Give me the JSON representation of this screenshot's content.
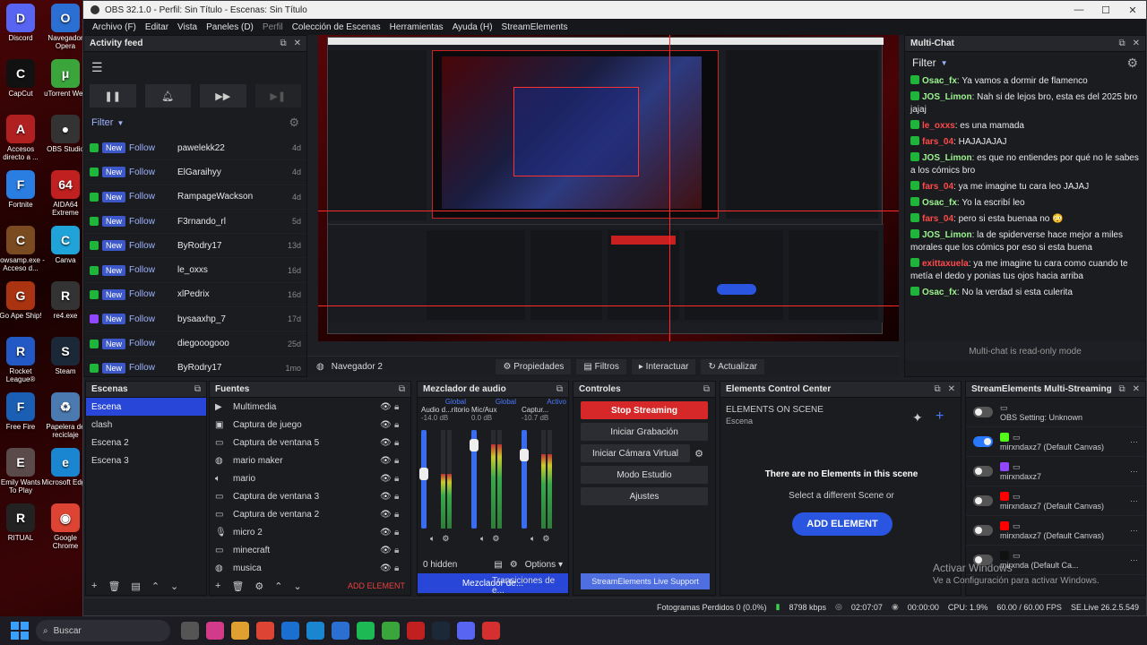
{
  "desktop": {
    "icons": [
      {
        "label": "Discord",
        "color": "#5865f2",
        "glyph": "D"
      },
      {
        "label": "Navegador Opera",
        "color": "#2a6fd1",
        "glyph": "O"
      },
      {
        "label": "CapCut",
        "color": "#111111",
        "glyph": "C"
      },
      {
        "label": "uTorrent Web",
        "color": "#3aa53a",
        "glyph": "μ"
      },
      {
        "label": "Accesos directo a ...",
        "color": "#b02020",
        "glyph": "A"
      },
      {
        "label": "OBS Studio",
        "color": "#333333",
        "glyph": "●"
      },
      {
        "label": "Fortnite",
        "color": "#2a7de1",
        "glyph": "F"
      },
      {
        "label": "AIDA64 Extreme",
        "color": "#c0201f",
        "glyph": "64"
      },
      {
        "label": "cowsamp.exe - Acceso d...",
        "color": "#7a4a20",
        "glyph": "C"
      },
      {
        "label": "Canva",
        "color": "#1fa3d8",
        "glyph": "C"
      },
      {
        "label": "Go Ape Ship!",
        "color": "#aa3311",
        "glyph": "G"
      },
      {
        "label": "re4.exe",
        "color": "#333333",
        "glyph": "R"
      },
      {
        "label": "Rocket League®",
        "color": "#2359c4",
        "glyph": "R"
      },
      {
        "label": "Steam",
        "color": "#1b2838",
        "glyph": "S"
      },
      {
        "label": "Free Fire",
        "color": "#1a5fb4",
        "glyph": "F"
      },
      {
        "label": "Papelera de reciclaje",
        "color": "#4a7ab0",
        "glyph": "♻"
      },
      {
        "label": "Emily Wants To Play",
        "color": "#5a4a4a",
        "glyph": "E"
      },
      {
        "label": "Microsoft Edge",
        "color": "#1a86d1",
        "glyph": "e"
      },
      {
        "label": "RITUAL",
        "color": "#222222",
        "glyph": "R"
      },
      {
        "label": "Google Chrome",
        "color": "#dd4433",
        "glyph": "◉"
      }
    ]
  },
  "window": {
    "title": "OBS 32.1.0 - Perfil: Sin Título - Escenas: Sin Título",
    "min": "—",
    "max": "☐",
    "close": "✕"
  },
  "menu": [
    "Archivo (F)",
    "Editar",
    "Vista",
    "Paneles (D)",
    "Perfil",
    "Colección de Escenas",
    "Herramientas",
    "Ayuda (H)",
    "StreamElements"
  ],
  "activity": {
    "title": "Activity feed",
    "filter": "Filter",
    "new": "New",
    "follow": "Follow",
    "items": [
      {
        "user": "pawelekk22",
        "time": "4d"
      },
      {
        "user": "ElGaraihyy",
        "time": "4d"
      },
      {
        "user": "RampageWackson",
        "time": "4d"
      },
      {
        "user": "F3rnando_rl",
        "time": "5d"
      },
      {
        "user": "ByRodry17",
        "time": "13d"
      },
      {
        "user": "le_oxxs",
        "time": "16d"
      },
      {
        "user": "xlPedrix",
        "time": "16d"
      },
      {
        "user": "bysaaxhp_7",
        "time": "17d"
      },
      {
        "user": "diegooogooo",
        "time": "25d"
      },
      {
        "user": "ByRodry17",
        "time": "1mo"
      }
    ]
  },
  "multichat": {
    "title": "Multi-Chat",
    "filter": "Filter",
    "footer": "Multi-chat is read-only mode",
    "messages": [
      {
        "user": "Osac_fx",
        "red": false,
        "text": "Ya vamos a dormir de flamenco"
      },
      {
        "user": "JOS_Limon",
        "red": false,
        "text": "Nah si de lejos bro, esta es del 2025 bro jajaj"
      },
      {
        "user": "le_oxxs",
        "red": true,
        "text": "es una mamada"
      },
      {
        "user": "fars_04",
        "red": true,
        "text": "HAJAJAJAJ"
      },
      {
        "user": "JOS_Limon",
        "red": false,
        "text": "es que no entiendes por qué no le sabes a los cómics bro"
      },
      {
        "user": "fars_04",
        "red": true,
        "text": "ya me imagine tu cara leo JAJAJ"
      },
      {
        "user": "Osac_fx",
        "red": false,
        "text": "Yo la escribí leo"
      },
      {
        "user": "fars_04",
        "red": true,
        "text": "pero si esta buenaa no 😳"
      },
      {
        "user": "JOS_Limon",
        "red": false,
        "text": "la de spiderverse hace mejor a miles morales que los cómics por eso si esta buena"
      },
      {
        "user": "exittaxuela",
        "red": true,
        "text": "ya me imagine tu cara como cuando te metía el dedo y ponias tus ojos hacia arriba"
      },
      {
        "user": "Osac_fx",
        "red": false,
        "text": "No la verdad si esta culerita"
      }
    ]
  },
  "preview_toolbar": {
    "source": "Navegador 2",
    "props": "Propiedades",
    "filters": "Filtros",
    "interact": "Interactuar",
    "refresh": "Actualizar"
  },
  "scenes": {
    "title": "Escenas",
    "items": [
      "Escena",
      "clash",
      "Escena 2",
      "Escena 3"
    ]
  },
  "sources": {
    "title": "Fuentes",
    "add_element": "ADD ELEMENT",
    "items": [
      {
        "name": "Multimedia",
        "icon": "play"
      },
      {
        "name": "Captura de juego",
        "icon": "game"
      },
      {
        "name": "Captura de ventana 5",
        "icon": "window"
      },
      {
        "name": "mario maker",
        "icon": "browser"
      },
      {
        "name": "mario",
        "icon": "audio"
      },
      {
        "name": "Captura de ventana 3",
        "icon": "window"
      },
      {
        "name": "Captura de ventana 2",
        "icon": "window"
      },
      {
        "name": "micro 2",
        "icon": "mic"
      },
      {
        "name": "minecraft",
        "icon": "window"
      },
      {
        "name": "musica",
        "icon": "browser"
      }
    ]
  },
  "mixer": {
    "title": "Mezclador de audio",
    "hidden": "0 hidden",
    "options": "Options",
    "tab_mixer": "Mezclador de...",
    "tab_transitions": "Transiciones de e...",
    "channels": [
      {
        "tag": "Global",
        "name": "Audio d...ritorio",
        "db": "-14.0 dB",
        "level": 0.55
      },
      {
        "tag": "Global",
        "name": "Mic/Aux",
        "db": "0.0 dB",
        "level": 0.85
      },
      {
        "tag": "Activo",
        "name": "Captur...",
        "db": "-10.7 dB",
        "level": 0.75
      }
    ],
    "scale": [
      "0",
      "-6",
      "-12",
      "-18",
      "-24",
      "-30",
      "-36",
      "-42",
      "-48",
      "-54",
      "-60"
    ]
  },
  "controls": {
    "title": "Controles",
    "stop": "Stop Streaming",
    "record": "Iniciar Grabación",
    "vcam": "Iniciar Cámara Virtual",
    "studio": "Modo Estudio",
    "settings": "Ajustes",
    "support": "StreamElements Live Support"
  },
  "ecc": {
    "title": "Elements Control Center",
    "on_scene": "ELEMENTS ON SCENE",
    "scene": "Escena",
    "empty": "There are no Elements in this scene",
    "hint": "Select a different Scene or",
    "add": "ADD ELEMENT"
  },
  "ms": {
    "title": "StreamElements Multi-Streaming",
    "rows": [
      {
        "label": "OBS Setting: Unknown",
        "platform": "",
        "on": false
      },
      {
        "label": "mirxndaxz7 (Default Canvas)",
        "platform": "kick",
        "on": true
      },
      {
        "label": "mirxndaxz7",
        "platform": "twitch",
        "on": false
      },
      {
        "label": "mirxndaxz7 (Default Canvas)",
        "platform": "youtube",
        "on": false
      },
      {
        "label": "mirxndaxz7 (Default Canvas)",
        "platform": "youtube",
        "on": false
      },
      {
        "label": "mirxnda (Default Ca...",
        "platform": "tiktok",
        "on": false
      }
    ]
  },
  "watermark": {
    "line1": "Activar Windows",
    "line2": "Ve a Configuración para activar Windows."
  },
  "status": {
    "dropped": "Fotogramas Perdidos 0 (0.0%)",
    "kbps": "8798 kbps",
    "live_time": "02:07:07",
    "rec_time": "00:00:00",
    "cpu": "CPU: 1.9%",
    "fps": "60.00 / 60.00 FPS",
    "version": "SE.Live 26.2.5.549"
  },
  "taskbar": {
    "search": "Buscar"
  },
  "colors": {
    "accent": "#2847d8",
    "stream_red": "#d62828",
    "kick": "#53fc18",
    "twitch": "#9146ff",
    "youtube": "#ff0000",
    "tiktok": "#111111"
  }
}
